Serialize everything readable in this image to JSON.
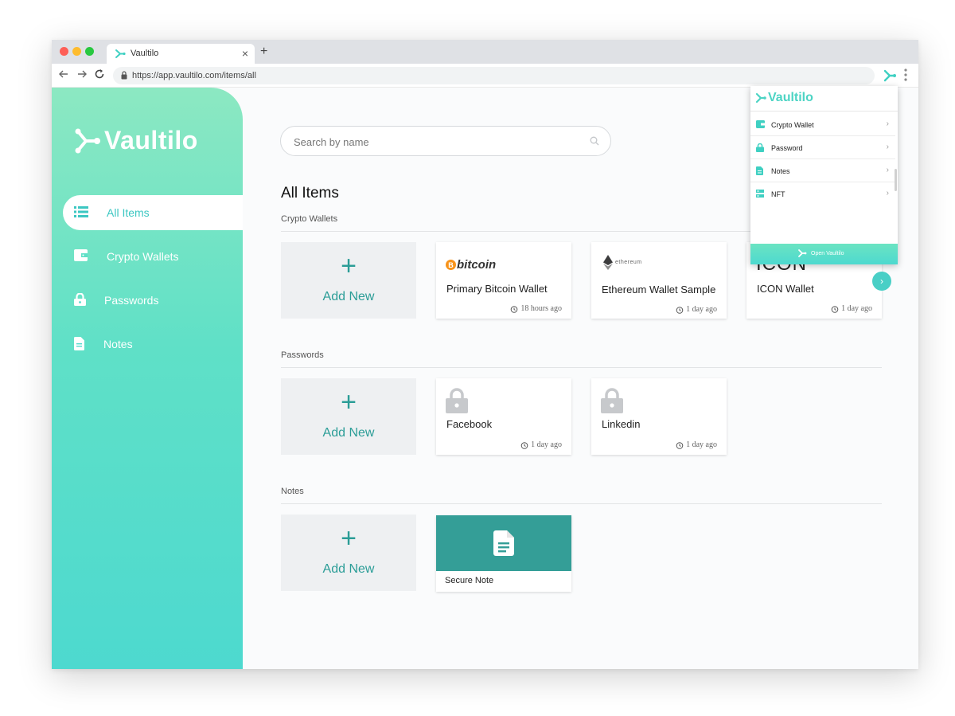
{
  "browser": {
    "tab_title": "Vaultilo",
    "tab_close": "×",
    "new_tab": "+",
    "url": "https://app.vaultilo.com/items/all"
  },
  "sidebar": {
    "brand": "Vaultilo",
    "items": [
      {
        "label": "All Items",
        "icon": "list-icon",
        "active": true
      },
      {
        "label": "Crypto Wallets",
        "icon": "wallet-icon",
        "active": false
      },
      {
        "label": "Passwords",
        "icon": "lock-icon",
        "active": false
      },
      {
        "label": "Notes",
        "icon": "document-icon",
        "active": false
      }
    ]
  },
  "main": {
    "search_placeholder": "Search by name",
    "page_title": "All Items",
    "add_new": "Add New",
    "add_plus": "+",
    "sections": {
      "crypto": {
        "label": "Crypto Wallets",
        "cards": [
          {
            "logo": "bitcoin",
            "name": "Primary Bitcoin Wallet",
            "time": "18 hours ago"
          },
          {
            "logo": "ethereum",
            "name": "Ethereum Wallet Sample",
            "time": "1 day ago"
          },
          {
            "logo": "ICON",
            "name": "ICON Wallet",
            "time": "1 day ago"
          }
        ]
      },
      "passwords": {
        "label": "Passwords",
        "cards": [
          {
            "name": "Facebook",
            "time": "1 day ago"
          },
          {
            "name": "Linkedin",
            "time": "1 day ago"
          }
        ]
      },
      "notes": {
        "label": "Notes",
        "cards": [
          {
            "name": "Secure Note"
          }
        ]
      }
    },
    "next_arrow": "›"
  },
  "popup": {
    "brand": "Vaultilo",
    "items": [
      {
        "label": "Crypto Wallet",
        "icon": "wallet-icon"
      },
      {
        "label": "Password",
        "icon": "lock-icon"
      },
      {
        "label": "Notes",
        "icon": "document-icon"
      },
      {
        "label": "NFT",
        "icon": "nft-icon"
      }
    ],
    "chevron": "›",
    "open_label": "Open Vaultilo"
  },
  "colors": {
    "accent": "#4dd4c4",
    "teal_dark": "#2b9d97",
    "note_bg": "#349e97",
    "bitcoin_orange": "#f7931a"
  }
}
